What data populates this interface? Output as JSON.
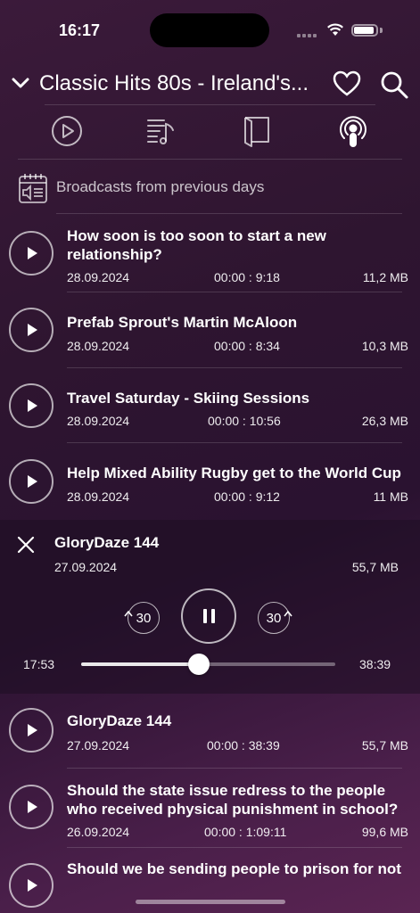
{
  "status": {
    "time": "16:17"
  },
  "header": {
    "title": "Classic Hits 80s - Ireland's..."
  },
  "tabs": [
    "play-tab",
    "playlist-tab",
    "book-tab",
    "podcast-tab"
  ],
  "section": {
    "label": "Broadcasts from previous days"
  },
  "episodes_top": [
    {
      "title": "How soon is too soon to start a new relationship?",
      "date": "28.09.2024",
      "duration": "00:00 : 9:18",
      "size": "11,2 MB"
    },
    {
      "title": "Prefab Sprout's Martin McAloon",
      "date": "28.09.2024",
      "duration": "00:00 : 8:34",
      "size": "10,3 MB"
    },
    {
      "title": "Travel Saturday - Skiing Sessions",
      "date": "28.09.2024",
      "duration": "00:00 : 10:56",
      "size": "26,3 MB"
    },
    {
      "title": "Help Mixed Ability Rugby get to the World Cup",
      "date": "28.09.2024",
      "duration": "00:00 : 9:12",
      "size": "11 MB"
    }
  ],
  "player": {
    "title": "GloryDaze 144",
    "date": "27.09.2024",
    "size": "55,7 MB",
    "rewind_label": "30",
    "forward_label": "30",
    "elapsed": "17:53",
    "total": "38:39",
    "progress": 0.463
  },
  "episodes_bottom": [
    {
      "title": "GloryDaze 144",
      "date": "27.09.2024",
      "duration": "00:00 : 38:39",
      "size": "55,7 MB"
    },
    {
      "title": "Should the state issue redress to the people who received physical punishment in school?",
      "date": "26.09.2024",
      "duration": "00:00 : 1:09:11",
      "size": "99,6 MB"
    },
    {
      "title": "Should we be sending people to prison for not"
    }
  ]
}
